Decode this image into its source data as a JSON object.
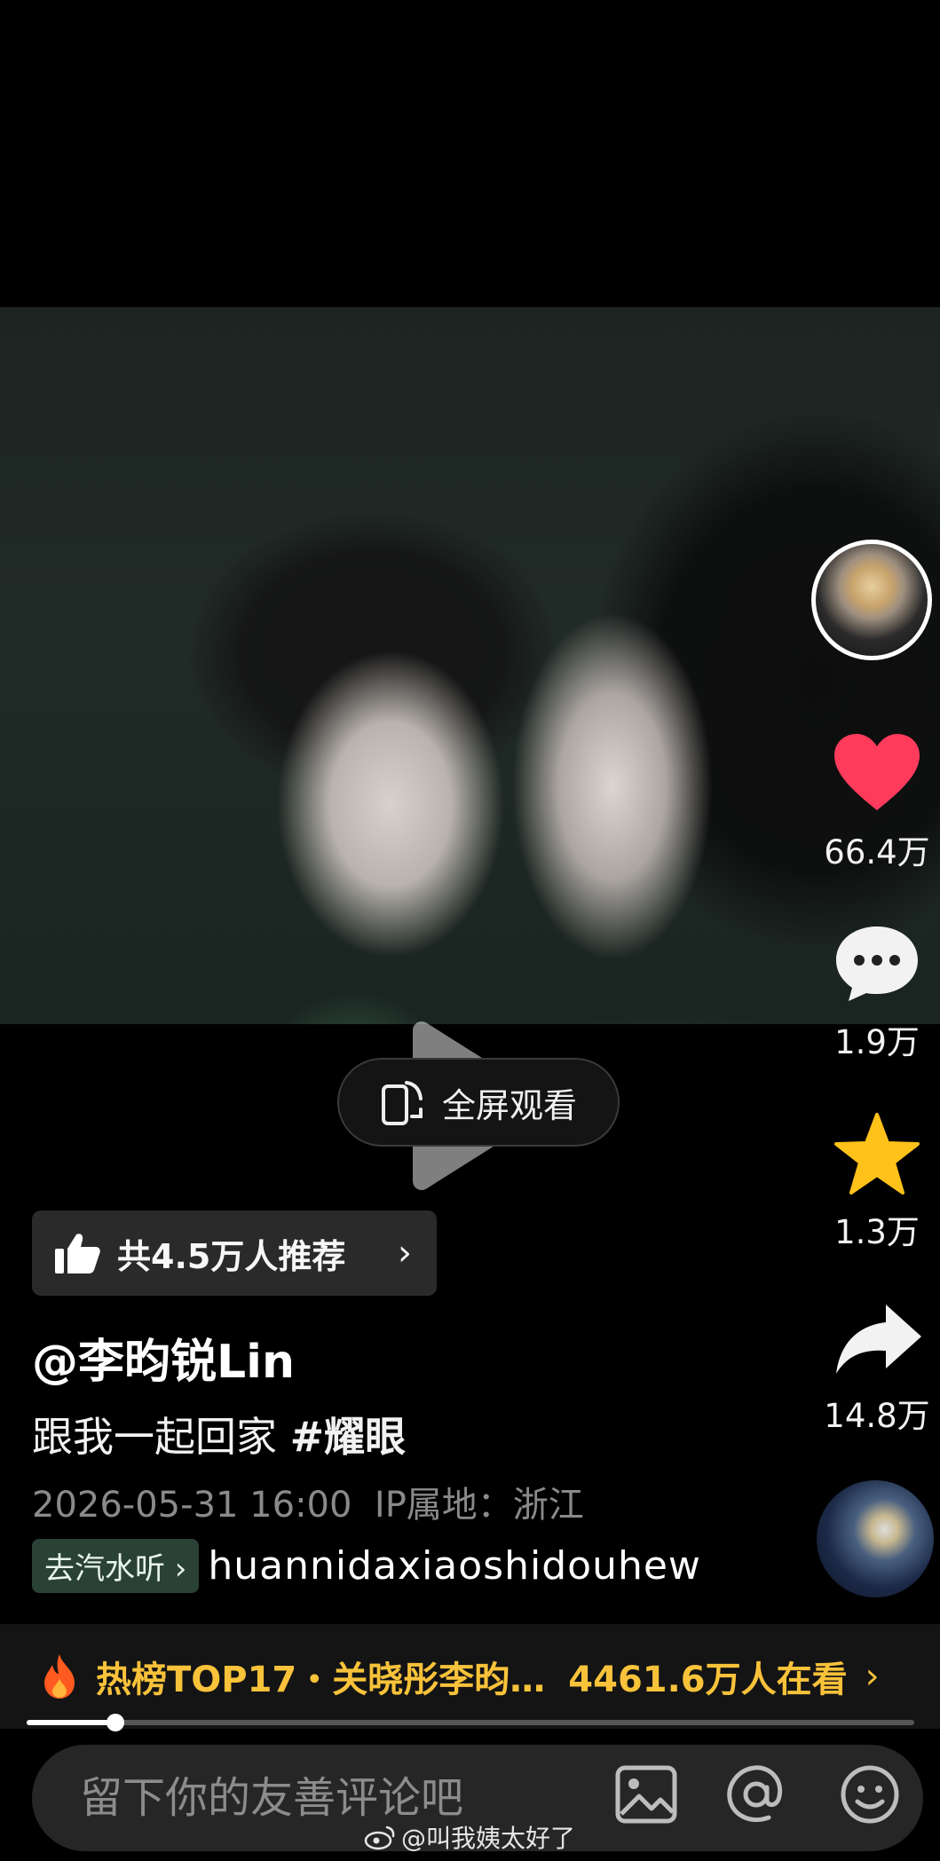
{
  "video": {
    "play_icon": "play-icon",
    "fullscreen_label": "全屏观看",
    "fullscreen_icon": "rotate-phone-icon"
  },
  "rail": {
    "author_avatar_icon": "avatar",
    "like_icon": "heart-icon",
    "like_count": "66.4万",
    "like_color": "#ff3b5c",
    "comment_icon": "comment-bubble-icon",
    "comment_count": "1.9万",
    "favorite_icon": "star-icon",
    "favorite_count": "1.3万",
    "favorite_color": "#ffc21a",
    "share_icon": "share-arrow-icon",
    "share_count": "14.8万",
    "music_disc_icon": "music-disc"
  },
  "recommend": {
    "label": "共4.5万人推荐",
    "icon": "thumbs-up-icon"
  },
  "post": {
    "author": "@李昀锐Lin",
    "caption_text": "跟我一起回家",
    "hashtag": "#耀眼",
    "date": "2026-05-31 16:00",
    "ip_location": "IP属地：浙江"
  },
  "music": {
    "soda_label": "去汽水听",
    "lyric": "huannidaxiaoshidouhew"
  },
  "hot": {
    "icon": "fire-icon",
    "rank_text": "热榜TOP17・关晓彤李昀…",
    "viewers": "4461.6万人在看",
    "accent_color": "#f8c23a"
  },
  "progress": {
    "fraction": 0.1
  },
  "comment_bar": {
    "placeholder": "留下你的友善评论吧",
    "image_icon": "image-icon",
    "at_icon": "at-icon",
    "emoji_icon": "emoji-icon"
  },
  "watermark": {
    "text": "@叫我姨太好了",
    "icon": "weibo-icon"
  }
}
